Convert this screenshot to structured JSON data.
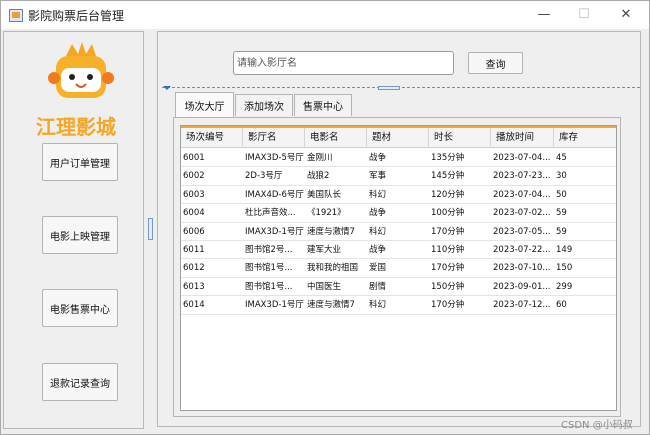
{
  "window": {
    "title": "影院购票后台管理",
    "minimize": "—",
    "maximize": "☐",
    "close": "✕"
  },
  "brand": {
    "logo_text": "江理影城",
    "colors": {
      "logo_orange": "#f5a623",
      "mascot_yellow": "#f9c32c",
      "mascot_face": "#f07b1f"
    }
  },
  "nav": [
    {
      "label": "用户订单管理"
    },
    {
      "label": "电影上映管理"
    },
    {
      "label": "电影售票中心"
    },
    {
      "label": "退款记录查询"
    }
  ],
  "search": {
    "placeholder": "请输入影厅名",
    "value": "",
    "button": "查询"
  },
  "tabs": [
    {
      "label": "场次大厅",
      "active": true
    },
    {
      "label": "添加场次",
      "active": false
    },
    {
      "label": "售票中心",
      "active": false
    }
  ],
  "table": {
    "columns": [
      "场次编号",
      "影厅名",
      "电影名",
      "题材",
      "时长",
      "播放时间",
      "库存"
    ],
    "rows": [
      [
        "6001",
        "IMAX3D-5号厅",
        "金刚川",
        "战争",
        "135分钟",
        "2023-07-04...",
        "45"
      ],
      [
        "6002",
        "2D-3号厅",
        "战狼2",
        "军事",
        "145分钟",
        "2023-07-23...",
        "30"
      ],
      [
        "6003",
        "IMAX4D-6号厅",
        "美国队长",
        "科幻",
        "120分钟",
        "2023-07-04...",
        "50"
      ],
      [
        "6004",
        "杜比声音效...",
        "《1921》",
        "战争",
        "100分钟",
        "2023-07-02...",
        "59"
      ],
      [
        "6006",
        "IMAX3D-1号厅",
        "速度与激情7",
        "科幻",
        "170分钟",
        "2023-07-05...",
        "59"
      ],
      [
        "6011",
        "图书馆2号...",
        "建军大业",
        "战争",
        "110分钟",
        "2023-07-22...",
        "149"
      ],
      [
        "6012",
        "图书馆1号...",
        "我和我的祖国",
        "爱国",
        "170分钟",
        "2023-07-10...",
        "150"
      ],
      [
        "6013",
        "图书馆1号...",
        "中国医生",
        "剧情",
        "150分钟",
        "2023-09-01...",
        "299"
      ],
      [
        "6014",
        "IMAX3D-1号厅",
        "速度与激情7",
        "科幻",
        "170分钟",
        "2023-07-12...",
        "60"
      ]
    ]
  },
  "watermark": "CSDN @小码叔"
}
